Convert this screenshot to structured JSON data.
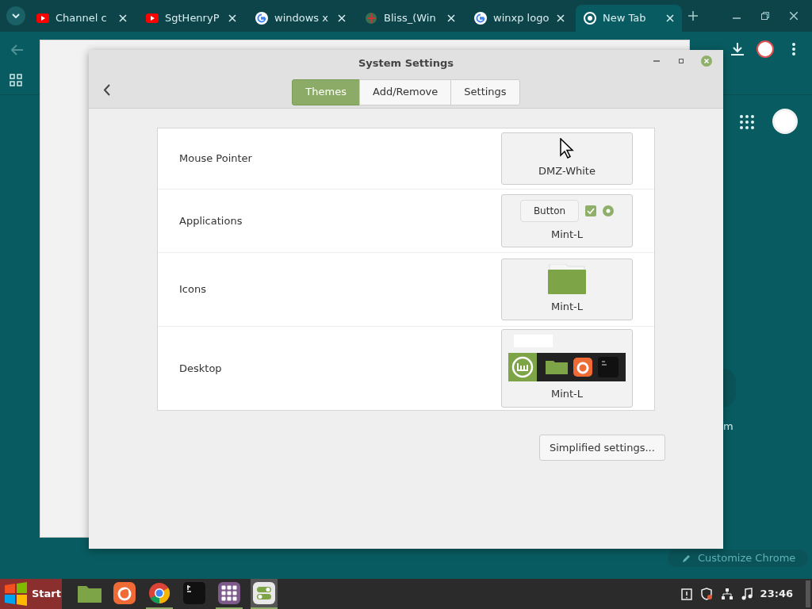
{
  "browser": {
    "tabs": [
      {
        "label": "Channel c",
        "selected": false
      },
      {
        "label": "SgtHenryP",
        "selected": false
      },
      {
        "label": "windows x",
        "selected": false
      },
      {
        "label": "Bliss_(Win",
        "selected": false
      },
      {
        "label": "winxp logo",
        "selected": false
      },
      {
        "label": "New Tab",
        "selected": true
      }
    ],
    "page_fragment": "m",
    "customize_button": "Customize Chrome"
  },
  "window": {
    "title": "System Settings",
    "tabs": [
      {
        "label": "Themes",
        "selected": true
      },
      {
        "label": "Add/Remove",
        "selected": false
      },
      {
        "label": "Settings",
        "selected": false
      }
    ],
    "rows": [
      {
        "label": "Mouse Pointer",
        "kind": "pointer",
        "theme": "DMZ-White"
      },
      {
        "label": "Applications",
        "kind": "widgets",
        "theme": "Mint-L",
        "sample_button": "Button"
      },
      {
        "label": "Icons",
        "kind": "folder",
        "theme": "Mint-L"
      },
      {
        "label": "Desktop",
        "kind": "panel",
        "theme": "Mint-L"
      }
    ],
    "simplified_button": "Simplified settings..."
  },
  "taskbar": {
    "start": "Start",
    "apps": [
      {
        "kind": "files",
        "running": false
      },
      {
        "kind": "firefox",
        "running": false
      },
      {
        "kind": "chrome",
        "running": true
      },
      {
        "kind": "terminal",
        "running": false
      },
      {
        "kind": "apps",
        "running": true
      },
      {
        "kind": "settings",
        "running": true
      }
    ],
    "clock": "23:46"
  }
}
